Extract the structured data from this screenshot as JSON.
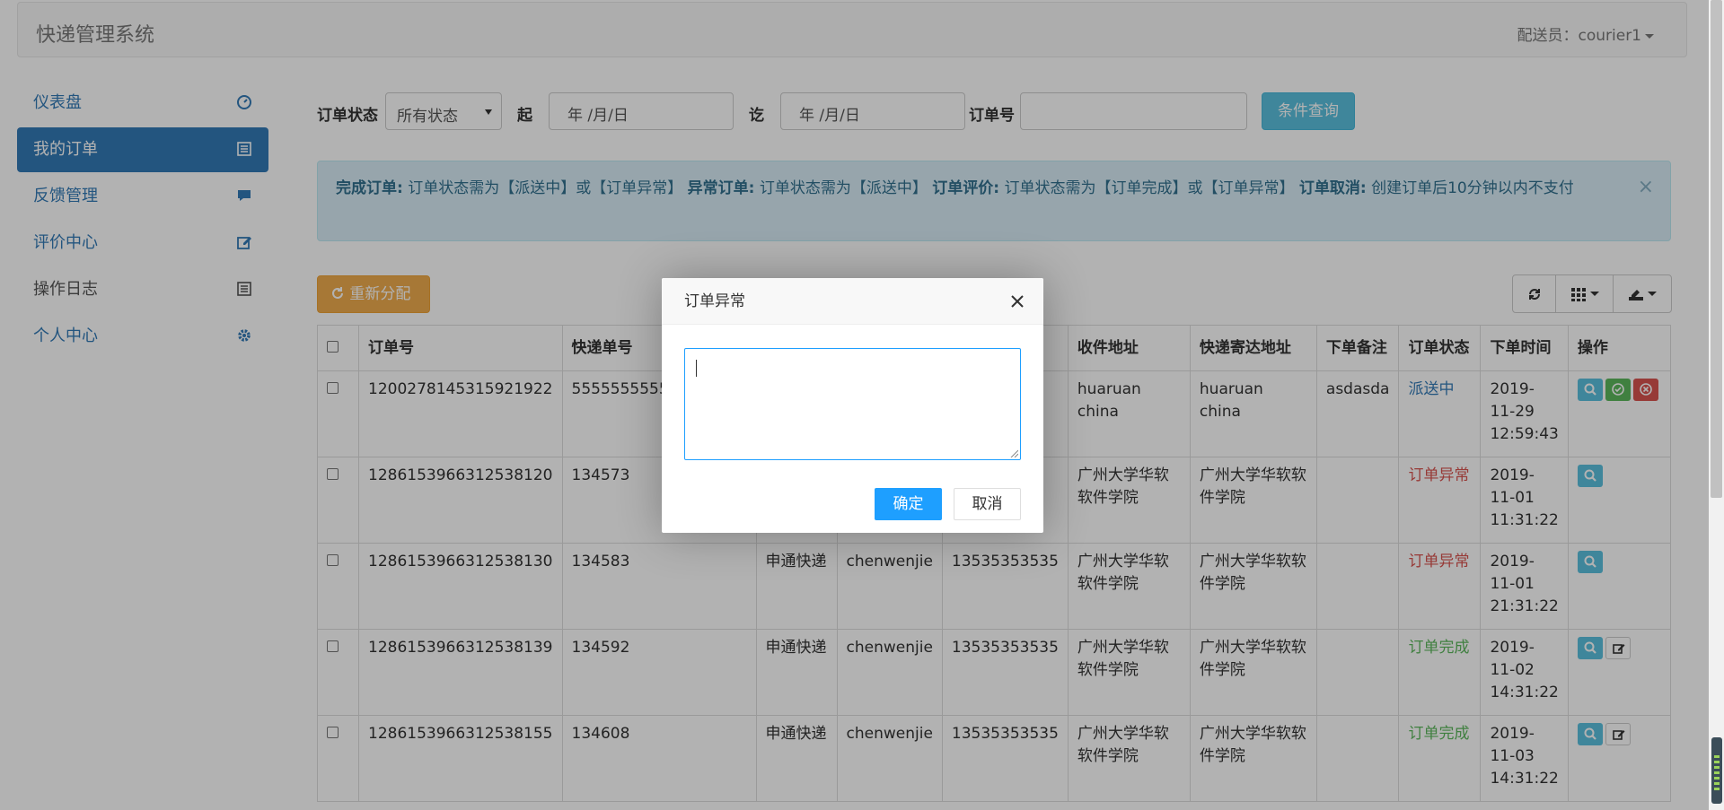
{
  "header": {
    "brand": "快递管理系统",
    "user": "配送员：courier1"
  },
  "sidebar": {
    "items": [
      {
        "label": "仪表盘",
        "icon": "dashboard-icon"
      },
      {
        "label": "我的订单",
        "icon": "list-icon"
      },
      {
        "label": "反馈管理",
        "icon": "comment-icon"
      },
      {
        "label": "评价中心",
        "icon": "edit-icon"
      },
      {
        "label": "操作日志",
        "icon": "list-icon"
      },
      {
        "label": "个人中心",
        "icon": "gear-icon"
      }
    ]
  },
  "filter": {
    "status_label": "订单状态",
    "status_value": "所有状态",
    "from_label": "起",
    "from_value": "年 /月/日",
    "to_label": "讫",
    "to_value": "年 /月/日",
    "order_label": "订单号",
    "order_value": "",
    "query_button": "条件查询"
  },
  "alert": {
    "t1": "完成订单:",
    "d1": "订单状态需为【派送中】或【订单异常】",
    "t2": "异常订单:",
    "d2": "订单状态需为【派送中】",
    "t3": "订单评价:",
    "d3": "订单状态需为【订单完成】或【订单异常】",
    "t4": "订单取消:",
    "d4": "创建订单后10分钟以内不支付",
    "close": "×"
  },
  "toolbar": {
    "reassign": "重新分配"
  },
  "table": {
    "headers": [
      "订单号",
      "快递单号",
      "",
      "",
      "",
      "收件地址",
      "快递寄达地址",
      "下单备注",
      "订单状态",
      "下单时间",
      "操作"
    ],
    "rows": [
      {
        "order": "1200278145315921922",
        "tracking": "5555555555555",
        "company": "",
        "name": "",
        "phone": "",
        "addr": "huaruan china",
        "dest": "huaruan china",
        "note": "asdasda",
        "status": "派送中",
        "status_class": "st-blue",
        "time": "2019-11-29 12:59:43",
        "actions": [
          "view",
          "complete",
          "cancel"
        ]
      },
      {
        "order": "1286153966312538120",
        "tracking": "134573",
        "company": "",
        "name": "",
        "phone": "",
        "addr": "广州大学华软软件学院",
        "dest": "广州大学华软软件学院",
        "note": "",
        "status": "订单异常",
        "status_class": "st-red",
        "time": "2019-11-01 11:31:22",
        "actions": [
          "view"
        ]
      },
      {
        "order": "1286153966312538130",
        "tracking": "134583",
        "company": "申通快递",
        "name": "chenwenjie",
        "phone": "13535353535",
        "addr": "广州大学华软软件学院",
        "dest": "广州大学华软软件学院",
        "note": "",
        "status": "订单异常",
        "status_class": "st-red",
        "time": "2019-11-01 21:31:22",
        "actions": [
          "view"
        ]
      },
      {
        "order": "1286153966312538139",
        "tracking": "134592",
        "company": "申通快递",
        "name": "chenwenjie",
        "phone": "13535353535",
        "addr": "广州大学华软软件学院",
        "dest": "广州大学华软软件学院",
        "note": "",
        "status": "订单完成",
        "status_class": "st-green",
        "time": "2019-11-02 14:31:22",
        "actions": [
          "view",
          "evaluate"
        ]
      },
      {
        "order": "1286153966312538155",
        "tracking": "134608",
        "company": "申通快递",
        "name": "chenwenjie",
        "phone": "13535353535",
        "addr": "广州大学华软软件学院",
        "dest": "广州大学华软软件学院",
        "note": "",
        "status": "订单完成",
        "status_class": "st-green",
        "time": "2019-11-03 14:31:22",
        "actions": [
          "view",
          "evaluate"
        ]
      }
    ]
  },
  "modal": {
    "title": "订单异常",
    "textarea_value": "",
    "ok": "确定",
    "cancel": "取消"
  },
  "colors": {
    "primary": "#337ab7",
    "info": "#5bc0de",
    "warning": "#f0ad4e",
    "danger": "#d9534f",
    "success": "#5cb85c",
    "layui_blue": "#1e9fff"
  }
}
